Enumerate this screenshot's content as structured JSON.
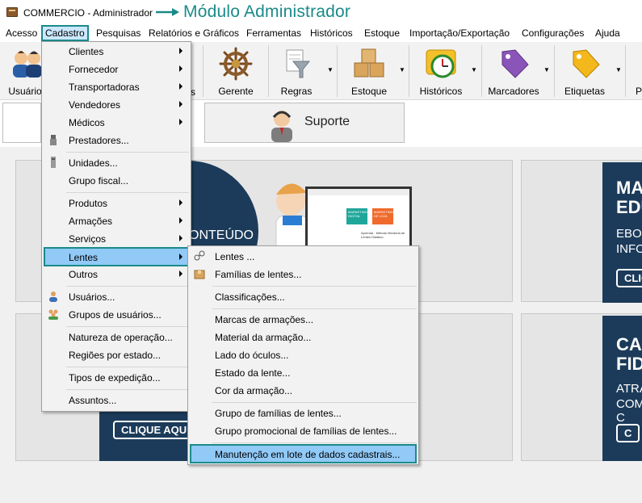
{
  "window": {
    "title": "COMMERCIO - Administrador",
    "module_title": "Módulo Administrador"
  },
  "menubar": {
    "items": [
      "Acesso",
      "Cadastro",
      "Pesquisas",
      "Relatórios e Gráficos",
      "Ferramentas",
      "Históricos",
      "Estoque",
      "Importação/Exportação",
      "Configurações",
      "Ajuda"
    ]
  },
  "toolbar": {
    "buttons": [
      "Usuários",
      "Gerente",
      "Regras",
      "Estoque",
      "Históricos",
      "Marcadores",
      "Etiquetas",
      "P"
    ],
    "partial_label": "s"
  },
  "tabs": {
    "suporte": "Suporte"
  },
  "banners": {
    "left_top_text": "ONTEÚDO",
    "left_bottom_button": "CLIQUE AQUI PA",
    "right_top_title": [
      "MAT",
      "EDU"
    ],
    "right_top_sub": [
      "EBOO",
      "INFOG"
    ],
    "right_top_button": "CLIC",
    "right_bottom_title": [
      "CAR",
      "FIDE"
    ],
    "right_bottom_sub": [
      "ATRA",
      "COM C"
    ],
    "right_bottom_button": "C",
    "preview_text": "Aprenda · Método Mentoria de Lentes Didático",
    "preview_cards": [
      "MARKETING DIGITAL",
      "MARKETING DE LOJA"
    ]
  },
  "cadastro_menu": {
    "items": [
      {
        "label": "Clientes",
        "submenu": true
      },
      {
        "label": "Fornecedor",
        "submenu": true
      },
      {
        "label": "Transportadoras",
        "submenu": true
      },
      {
        "label": "Vendedores",
        "submenu": true
      },
      {
        "label": "Médicos",
        "submenu": true
      },
      {
        "label": "Prestadores...",
        "submenu": false
      },
      {
        "label": "Unidades...",
        "submenu": false
      },
      {
        "label": "Grupo fiscal...",
        "submenu": false
      },
      {
        "label": "Produtos",
        "submenu": true
      },
      {
        "label": "Armações",
        "submenu": true
      },
      {
        "label": "Serviços",
        "submenu": true
      },
      {
        "label": "Lentes",
        "submenu": true
      },
      {
        "label": "Outros",
        "submenu": true
      },
      {
        "label": "Usuários...",
        "submenu": false
      },
      {
        "label": "Grupos de usuários...",
        "submenu": false
      },
      {
        "label": "Natureza de operação...",
        "submenu": false
      },
      {
        "label": "Regiões por estado...",
        "submenu": false
      },
      {
        "label": "Tipos de expedição...",
        "submenu": false
      },
      {
        "label": "Assuntos...",
        "submenu": false
      }
    ]
  },
  "lentes_menu": {
    "items": [
      "Lentes ...",
      "Famílias de lentes...",
      "Classificações...",
      "Marcas de armações...",
      "Material da armação...",
      "Lado do óculos...",
      "Estado da lente...",
      "Cor da armação...",
      "Grupo de famílias de lentes...",
      "Grupo promocional de famílias de lentes...",
      "Manutenção em lote de dados cadastrais..."
    ]
  },
  "colors": {
    "accent": "#1b8a8a",
    "highlight": "#91c9f7",
    "banner_dark": "#1c3b5a"
  }
}
